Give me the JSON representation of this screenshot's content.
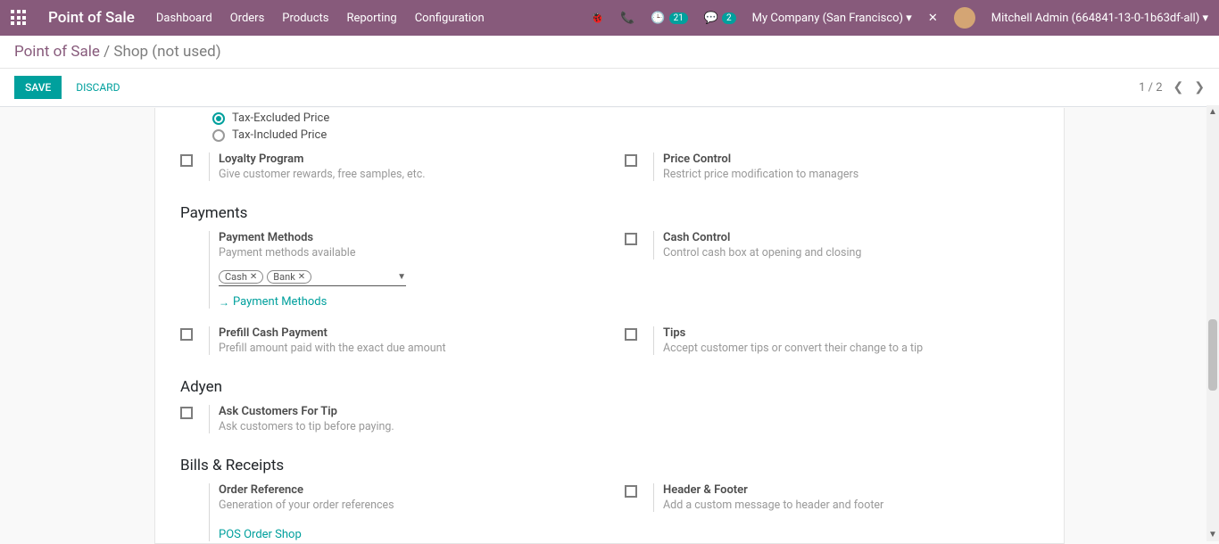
{
  "nav": {
    "brand": "Point of Sale",
    "menu": [
      "Dashboard",
      "Orders",
      "Products",
      "Reporting",
      "Configuration"
    ],
    "activity_count": "21",
    "chat_count": "2",
    "company": "My Company (San Francisco)",
    "user": "Mitchell Admin (664841-13-0-1b63df-all)"
  },
  "breadcrumb": {
    "root": "Point of Sale",
    "current": "Shop (not used)"
  },
  "actions": {
    "save": "SAVE",
    "discard": "DISCARD",
    "pager": "1 / 2"
  },
  "radios": {
    "excluded": "Tax-Excluded Price",
    "included": "Tax-Included Price"
  },
  "loyalty": {
    "title": "Loyalty Program",
    "desc": "Give customer rewards, free samples, etc."
  },
  "price_control": {
    "title": "Price Control",
    "desc": "Restrict price modification to managers"
  },
  "sections": {
    "payments": "Payments",
    "adyen": "Adyen",
    "bills": "Bills & Receipts"
  },
  "payment_methods": {
    "title": "Payment Methods",
    "desc": "Payment methods available",
    "tags": [
      "Cash",
      "Bank"
    ],
    "link": "Payment Methods"
  },
  "cash_control": {
    "title": "Cash Control",
    "desc": "Control cash box at opening and closing"
  },
  "prefill": {
    "title": "Prefill Cash Payment",
    "desc": "Prefill amount paid with the exact due amount"
  },
  "tips": {
    "title": "Tips",
    "desc": "Accept customer tips or convert their change to a tip"
  },
  "ask_tip": {
    "title": "Ask Customers For Tip",
    "desc": "Ask customers to tip before paying."
  },
  "order_ref": {
    "title": "Order Reference",
    "desc": "Generation of your order references",
    "link": "POS Order Shop"
  },
  "header_footer": {
    "title": "Header & Footer",
    "desc": "Add a custom message to header and footer"
  }
}
